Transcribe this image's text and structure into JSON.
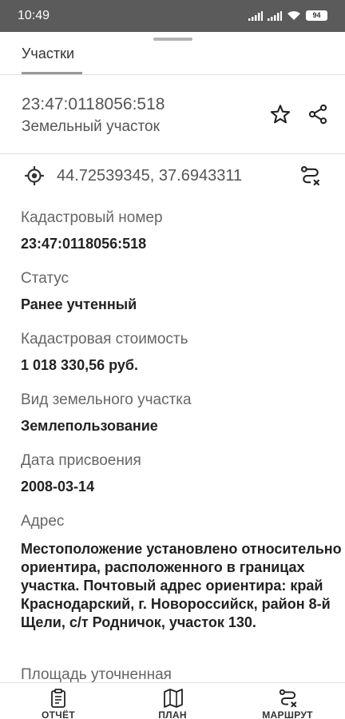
{
  "status_bar": {
    "time": "10:49",
    "battery": "94"
  },
  "tabs": [
    {
      "label": "Участки"
    }
  ],
  "parcel": {
    "number": "23:47:0118056:518",
    "type": "Земельный участок",
    "coordinates": "44.72539345, 37.6943311"
  },
  "fields": [
    {
      "label": "Кадастровый номер",
      "value": "23:47:0118056:518"
    },
    {
      "label": "Статус",
      "value": "Ранее учтенный"
    },
    {
      "label": "Кадастровая стоимость",
      "value": "1 018 330,56 руб."
    },
    {
      "label": "Вид земельного участка",
      "value": "Землепользование"
    },
    {
      "label": "Дата присвоения",
      "value": "2008-03-14"
    },
    {
      "label": "Адрес",
      "value": "Местоположение установлено относительно ориентира, расположенного в границах участка. Почтовый адрес ориентира: край Краснодарский, г. Новороссийск, район 8-й Щели, с/т Родничок, участок 130."
    },
    {
      "label": "Площадь уточненная"
    }
  ],
  "bottom_nav": [
    {
      "label": "ОТЧЁТ",
      "icon": "report-icon"
    },
    {
      "label": "ПЛАН",
      "icon": "map-icon"
    },
    {
      "label": "МАРШРУТ",
      "icon": "route-icon"
    }
  ],
  "colors": {
    "status_bar": "#5b5b5b",
    "text": "#222222",
    "muted": "#666666"
  }
}
